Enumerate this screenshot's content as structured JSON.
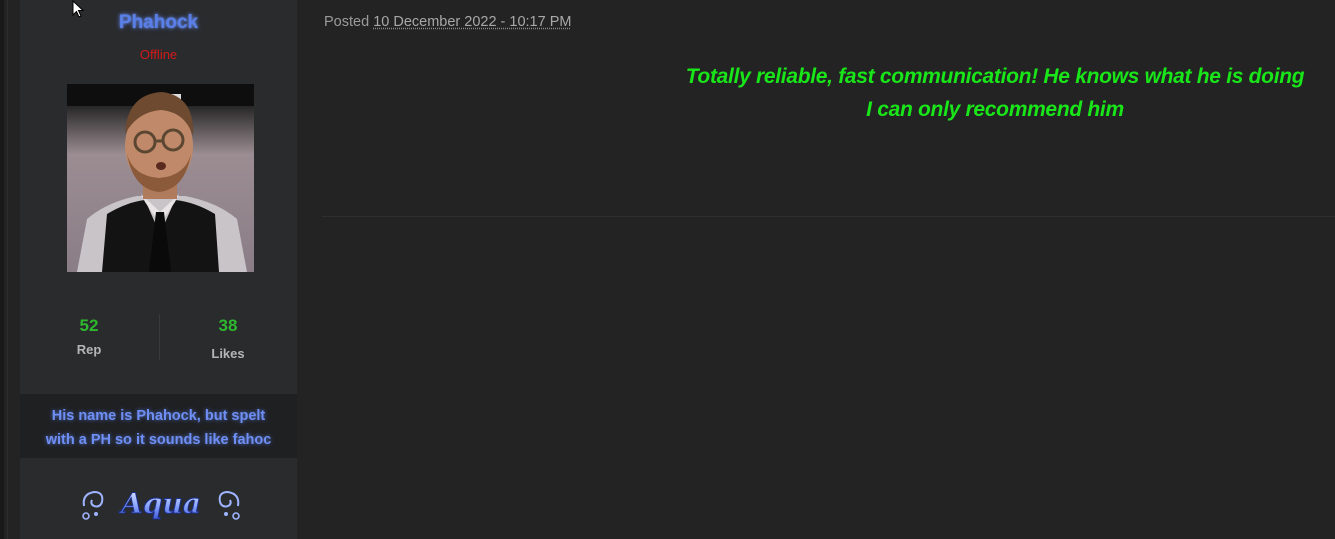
{
  "author": {
    "name": "Phahock",
    "status": "Offline",
    "name_color": "#5a7fe8",
    "status_color": "#d11a1a"
  },
  "stats": {
    "rep_value": "52",
    "rep_label": "Rep",
    "likes_value": "38",
    "likes_label": "Likes"
  },
  "signature": {
    "line1": "His name is Phahock, but spelt",
    "line2": "with a PH so it sounds like fahoc"
  },
  "badge": {
    "text": "Aqua"
  },
  "post": {
    "posted_prefix": "Posted",
    "date": "10 December 2022 - 10:17 PM",
    "line1": "Totally reliable, fast communication! He knows what he is doing",
    "line2": "I can only recommend him",
    "text_color": "#19e619"
  },
  "icons": [
    "mouse-cursor-icon",
    "avatar-image",
    "aqua-badge-icon"
  ]
}
